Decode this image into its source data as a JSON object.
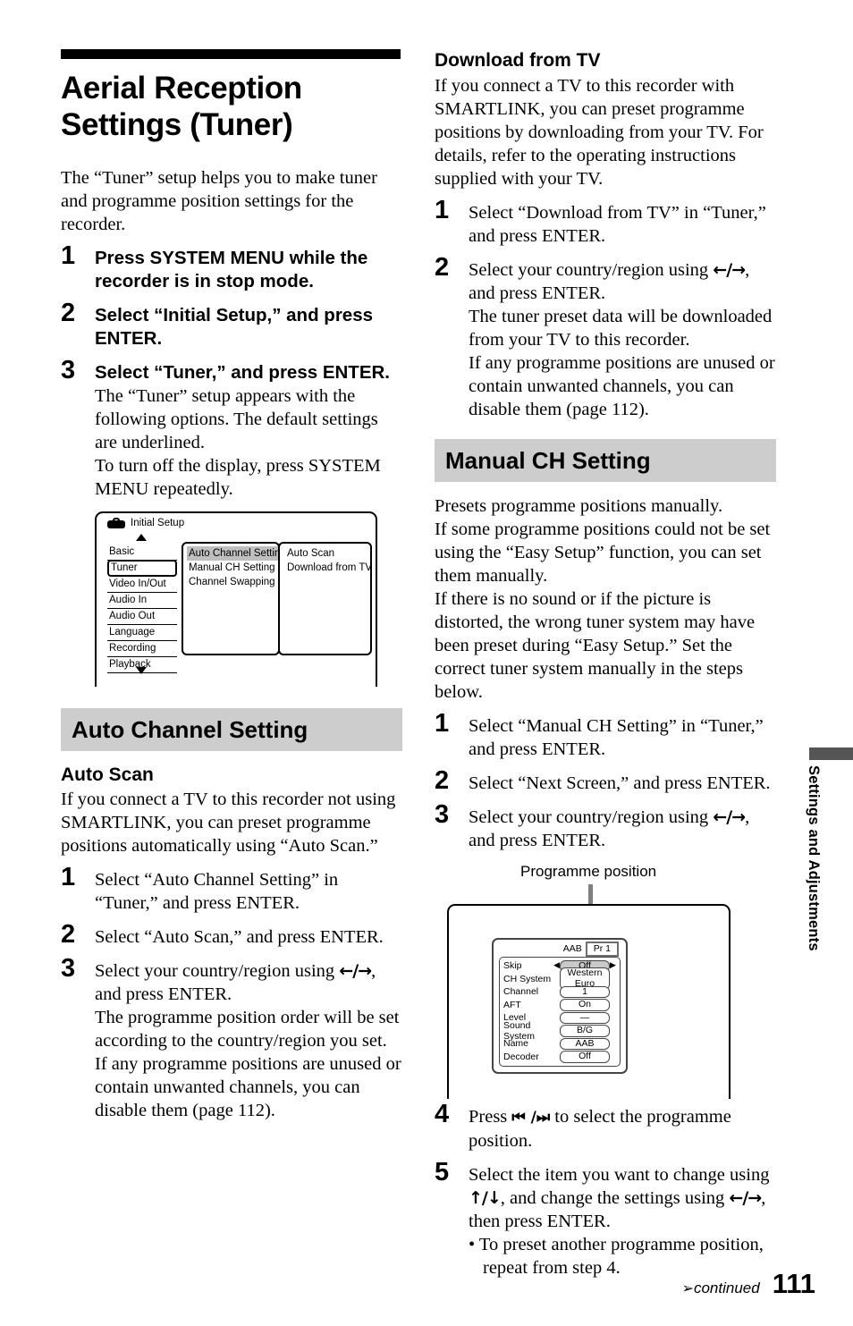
{
  "page": {
    "number": "111",
    "continued_label": "continued",
    "side_tab": "Settings and Adjustments"
  },
  "left_column": {
    "title": "Aerial Reception Settings (Tuner)",
    "intro": "The “Tuner” setup helps you to make tuner and programme position settings for the recorder.",
    "steps": [
      {
        "num": "1",
        "lead_bold": "Press SYSTEM MENU while the recorder is in stop mode."
      },
      {
        "num": "2",
        "lead_bold": "Select “Initial Setup,” and press ENTER."
      },
      {
        "num": "3",
        "lead_bold": "Select “Tuner,” and press ENTER.",
        "sub1": "The “Tuner” setup appears with the following options. The default settings are underlined.",
        "sub2": "To turn off the display, press SYSTEM MENU repeatedly."
      }
    ],
    "menu_figure": {
      "title": "Initial Setup",
      "icon": "toolbox-icon",
      "column1": [
        "Basic",
        "Tuner",
        "Video In/Out",
        "Audio In",
        "Audio Out",
        "Language",
        "Recording",
        "Playback"
      ],
      "column1_selected": "Tuner",
      "column2": [
        "Auto Channel Setting",
        "Manual CH Setting",
        "Channel Swapping"
      ],
      "column2_highlighted": "Auto Channel Setting",
      "column3": [
        "Auto Scan",
        "Download from TV"
      ]
    },
    "section": {
      "heading": "Auto Channel Setting",
      "sub_heading": "Auto Scan",
      "body": "If you connect a TV to this recorder not using SMARTLINK, you can preset programme positions automatically using “Auto Scan.”",
      "steps": [
        {
          "num": "1",
          "lead": "Select “Auto Channel Setting” in “Tuner,” and press ENTER."
        },
        {
          "num": "2",
          "lead": "Select “Auto Scan,” and press ENTER."
        },
        {
          "num": "3",
          "lead_pre": "Select your country/region using ",
          "lead_arrows": "←/→",
          "lead_post": ", and press ENTER.",
          "sub1": "The programme position order will be set according to the country/region you set.",
          "sub2": "If any programme positions are unused or contain unwanted channels, you can disable them (page 112)."
        }
      ]
    }
  },
  "right_column": {
    "download": {
      "sub_heading": "Download from TV",
      "body": "If you connect a TV to this recorder with SMARTLINK, you can preset programme positions by downloading from your TV. For details, refer to the operating instructions supplied with your TV.",
      "steps": [
        {
          "num": "1",
          "lead": "Select “Download from TV” in “Tuner,” and press ENTER."
        },
        {
          "num": "2",
          "lead_pre": "Select your country/region using ",
          "lead_arrows": "←/→",
          "lead_post": ", and press ENTER.",
          "sub1": "The tuner preset data will be downloaded from your TV to this recorder.",
          "sub2": "If any programme positions are unused or contain unwanted channels, you can disable them (page 112)."
        }
      ]
    },
    "manual": {
      "heading": "Manual CH Setting",
      "body1": "Presets programme positions manually.",
      "body2": "If some programme positions could not be set using the “Easy Setup” function, you can set them manually.",
      "body3": "If there is no sound or if the picture is distorted, the wrong tuner system may have been preset during “Easy Setup.” Set the correct tuner system manually in the steps below.",
      "steps_top": [
        {
          "num": "1",
          "lead": "Select “Manual CH Setting” in “Tuner,” and press ENTER."
        },
        {
          "num": "2",
          "lead": "Select “Next Screen,” and press ENTER."
        },
        {
          "num": "3",
          "lead_pre": "Select your country/region using ",
          "lead_arrows": "←/→",
          "lead_post": ", and press ENTER."
        }
      ],
      "tv_figure": {
        "caption": "Programme position",
        "name_label": "AAB",
        "pr_label": "Pr 1",
        "rows": [
          {
            "label": "Skip",
            "value": "Off",
            "active": true
          },
          {
            "label": "CH System",
            "value": "Western Euro",
            "active": false
          },
          {
            "label": "Channel",
            "value": "1",
            "active": false
          },
          {
            "label": "AFT",
            "value": "On",
            "active": false
          },
          {
            "label": "Level",
            "value": "—",
            "active": false
          },
          {
            "label": "Sound System",
            "value": "B/G",
            "active": false
          },
          {
            "label": "Name",
            "value": "AAB",
            "active": false
          },
          {
            "label": "Decoder",
            "value": "Off",
            "active": false
          }
        ]
      },
      "steps_bottom": [
        {
          "num": "4",
          "lead_pre": "Press ",
          "lead_arrows": "⏮ /⏭",
          "lead_post": " to select the programme position."
        },
        {
          "num": "5",
          "lead_pre": "Select the item you want to change using ",
          "lead_arrows": "↑/↓",
          "lead_mid": ", and change the settings using ",
          "lead_arrows2": "←/→",
          "lead_post": ", then press ENTER.",
          "bullet": "• To preset another programme position, repeat from step 4."
        }
      ]
    }
  }
}
